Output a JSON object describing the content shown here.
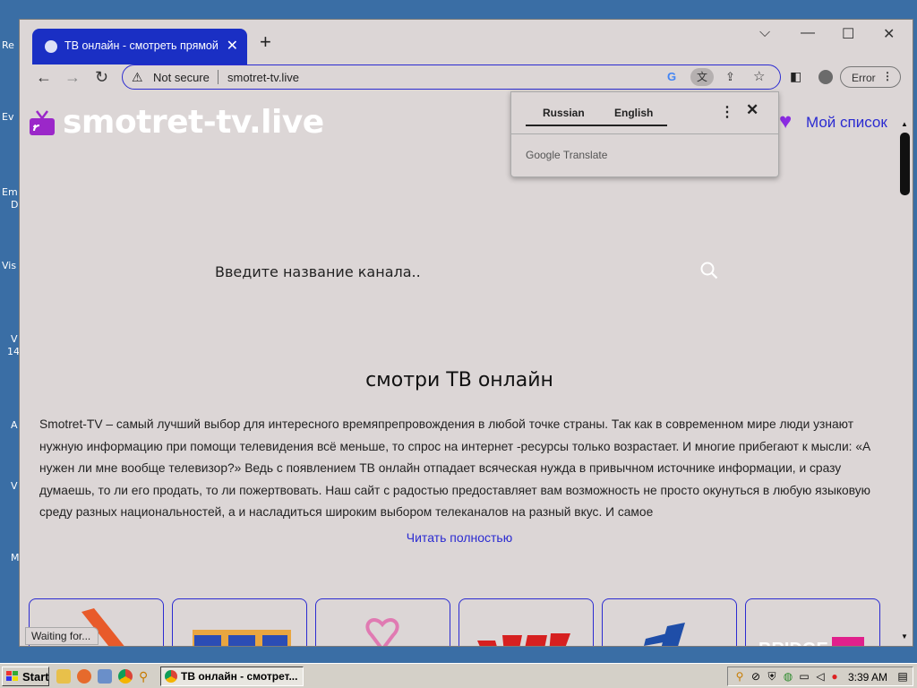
{
  "desktop": {
    "labels": [
      "Re",
      "Ev",
      "Em",
      "D",
      "Vis",
      "V",
      "14",
      "A",
      "V",
      "M"
    ]
  },
  "browser": {
    "tab": {
      "title": "ТВ онлайн - смотреть прямой э",
      "close": "✕"
    },
    "new_tab": "+",
    "window_controls": {
      "dropdown": "⌵",
      "minimize": "—",
      "maximize": "☐",
      "close": "✕"
    },
    "nav": {
      "back": "←",
      "forward": "→",
      "reload": "↻"
    },
    "omnibox": {
      "security": "Not secure",
      "url": "smotret-tv.live"
    },
    "error_button": "Error",
    "status": "Waiting for..."
  },
  "translate_popup": {
    "source_lang": "Russian",
    "target_lang": "English",
    "brand_google": "Google",
    "brand_translate": "Translate"
  },
  "page": {
    "logo": "smotret-tv.live",
    "my_list": "Мой список",
    "search": {
      "placeholder": "Введите название канала.."
    },
    "heading": "смотри ТВ онлайн",
    "description": "Smotret-TV – самый лучший выбор для интересного времяпрепровождения в любой точке страны. Так как в современном мире люди узнают нужную информацию при помощи телевидения всё меньше, то спрос на интернет -ресурсы только возрастает. И многие прибегают к мысли: «А нужен ли мне вообще телевизор?» Ведь с появлением ТВ онлайн отпадает всяческая нужда в привычном источнике информации, и сразу думаешь, то ли его продать, то ли пожертвовать. Наш сайт с радостью предоставляет вам возможность не просто окунуться в любую языковую среду разных национальностей, а и насладиться широким выбором телеканалов на разный вкус. И самое",
    "read_more": "Читать полностью",
    "channel_cards": [
      "channel-1",
      "channel-2",
      "channel-3",
      "channel-4",
      "channel-5",
      "channel-6"
    ]
  },
  "taskbar": {
    "start": "Start",
    "task_title": "ТВ онлайн - смотрет...",
    "clock": "3:39 AM"
  },
  "colors": {
    "accent": "#2b2bd1",
    "tab": "#1a2fc4",
    "page_bg": "#dcd6d6",
    "heart": "#8a2be2"
  }
}
